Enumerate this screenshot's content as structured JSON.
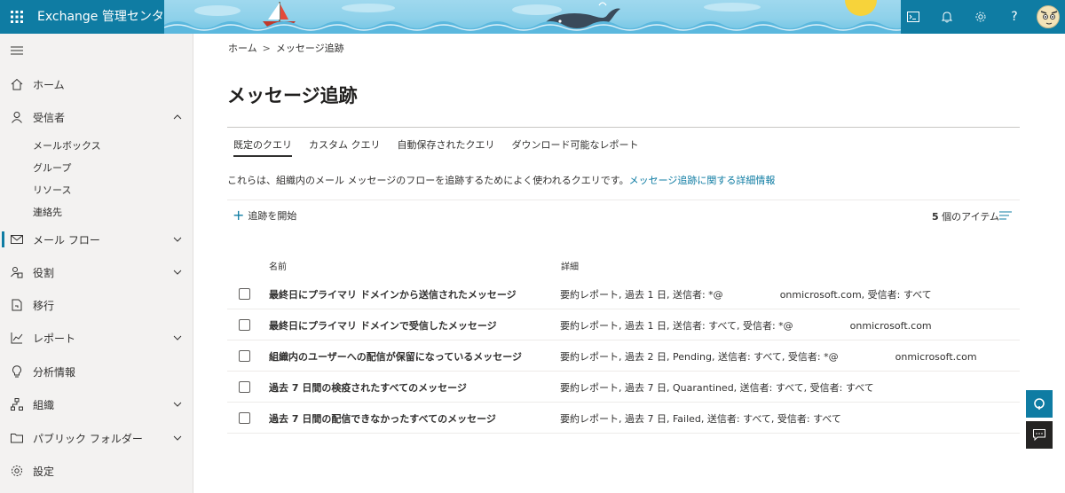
{
  "app": {
    "title": "Exchange 管理センター"
  },
  "topbar": {
    "icons": [
      "cloud-shell-icon",
      "bell-icon",
      "gear-icon",
      "help-icon"
    ],
    "help_label": "?"
  },
  "sidebar": {
    "items": [
      {
        "label": "ホーム",
        "icon": "home-icon",
        "expandable": false
      },
      {
        "label": "受信者",
        "icon": "person-icon",
        "expandable": true,
        "expanded": true,
        "children": [
          "メールボックス",
          "グループ",
          "リソース",
          "連絡先"
        ]
      },
      {
        "label": "メール フロー",
        "icon": "mail-icon",
        "expandable": true,
        "active": true
      },
      {
        "label": "役割",
        "icon": "roles-icon",
        "expandable": true
      },
      {
        "label": "移行",
        "icon": "migration-icon",
        "expandable": false
      },
      {
        "label": "レポート",
        "icon": "chart-icon",
        "expandable": true
      },
      {
        "label": "分析情報",
        "icon": "lightbulb-icon",
        "expandable": false
      },
      {
        "label": "組織",
        "icon": "org-icon",
        "expandable": true
      },
      {
        "label": "パブリック フォルダー",
        "icon": "folder-icon",
        "expandable": true
      },
      {
        "label": "設定",
        "icon": "gear-icon",
        "expandable": false
      }
    ]
  },
  "breadcrumb": {
    "home": "ホーム",
    "separator": ">",
    "current": "メッセージ追跡"
  },
  "page": {
    "title": "メッセージ追跡"
  },
  "tabs": [
    {
      "label": "既定のクエリ",
      "active": true
    },
    {
      "label": "カスタム クエリ",
      "active": false
    },
    {
      "label": "自動保存されたクエリ",
      "active": false
    },
    {
      "label": "ダウンロード可能なレポート",
      "active": false
    }
  ],
  "description": {
    "text": "これらは、組織内のメール メッセージのフローを追跡するためによく使われるクエリです。",
    "link": "メッセージ追跡に関する詳細情報"
  },
  "commandbar": {
    "start_label": "追跡を開始",
    "count_number": "5",
    "count_suffix": " 個のアイテム"
  },
  "table": {
    "headers": {
      "name": "名前",
      "detail": "詳細"
    },
    "rows": [
      {
        "name": "最終日にプライマリ ドメインから送信されたメッセージ",
        "detail_a": "要約レポート, 過去 1 日, 送信者: *@",
        "detail_b": "onmicrosoft.com, 受信者: すべて"
      },
      {
        "name": "最終日にプライマリ ドメインで受信したメッセージ",
        "detail_a": "要約レポート, 過去 1 日, 送信者: すべて, 受信者: *@",
        "detail_b": "onmicrosoft.com"
      },
      {
        "name": "組織内のユーザーへの配信が保留になっているメッセージ",
        "detail_a": "要約レポート, 過去 2 日, Pending, 送信者: すべて, 受信者: *@",
        "detail_b": "onmicrosoft.com"
      },
      {
        "name": "過去 7 日間の検疫されたすべてのメッセージ",
        "detail_a": "要約レポート, 過去 7 日, Quarantined, 送信者: すべて, 受信者: すべて",
        "detail_b": ""
      },
      {
        "name": "過去 7 日間の配信できなかったすべてのメッセージ",
        "detail_a": "要約レポート, 過去 7 日, Failed, 送信者: すべて, 受信者: すべて",
        "detail_b": ""
      }
    ]
  },
  "colors": {
    "accent": "#0f7ca3",
    "banner_sky": "#8ed1ea",
    "sidebar_bg": "#f3f2f1",
    "chat_bg": "#252423"
  }
}
